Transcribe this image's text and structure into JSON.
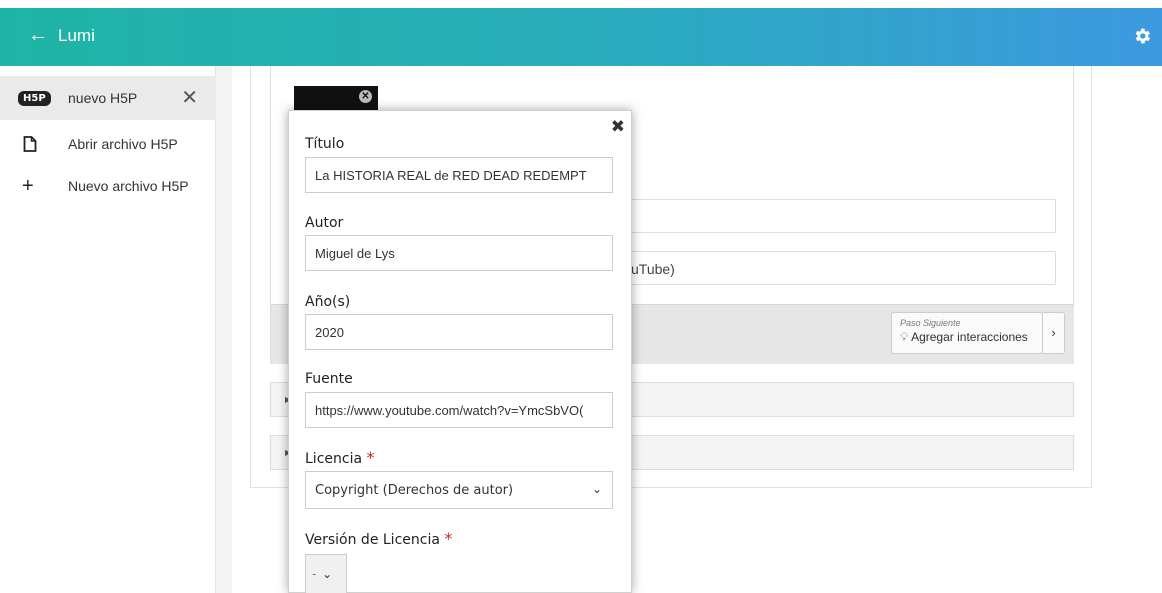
{
  "app": {
    "title": "Lumi",
    "back_icon": "arrow-left-icon",
    "settings_icon": "gear-icon",
    "accent_start": "#1fb5a6",
    "accent_end": "#3d9ae0"
  },
  "sidebar": {
    "items": [
      {
        "label": "nuevo H5P",
        "badge": "H5P",
        "close": "✕",
        "active": true
      },
      {
        "label": "Abrir archivo H5P",
        "icon": "file-icon"
      },
      {
        "label": "Nuevo archivo H5P",
        "icon": "plus-icon"
      }
    ]
  },
  "editor": {
    "field2_partial": "uTube)",
    "next_step": {
      "caption": "Paso Siguiente",
      "label": "Agregar interacciones",
      "arrow": "›"
    }
  },
  "metadata_popup": {
    "close": "✖",
    "fields": {
      "title": {
        "label": "Título",
        "value": "La HISTORIA REAL de RED DEAD REDEMPT"
      },
      "author": {
        "label": "Autor",
        "value": "Miguel de Lys"
      },
      "years": {
        "label": "Año(s)",
        "value": "2020"
      },
      "source": {
        "label": "Fuente",
        "value": "https://www.youtube.com/watch?v=YmcSbVO("
      },
      "license": {
        "label": "Licencia",
        "required_mark": "*",
        "value": "Copyright (Derechos de autor)"
      },
      "license_version": {
        "label": "Versión de Licencia",
        "required_mark": "*",
        "value": "-"
      }
    }
  }
}
